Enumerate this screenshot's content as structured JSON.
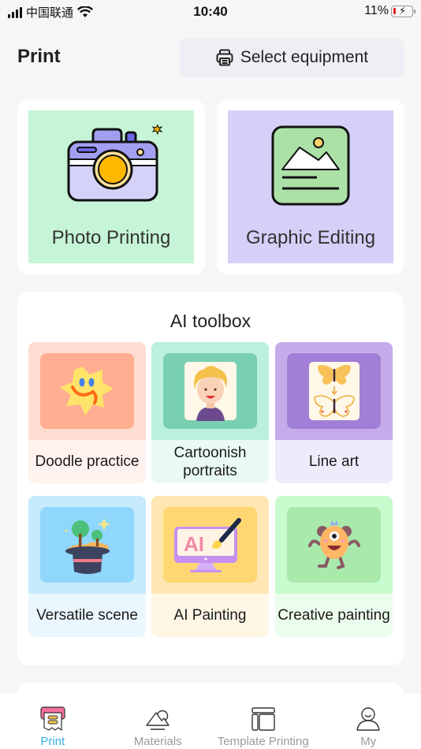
{
  "status_bar": {
    "carrier": "中国联通",
    "time": "10:40",
    "battery_percent": "11%",
    "battery_level": 0.11,
    "charging": true
  },
  "header": {
    "title": "Print",
    "select_equipment_label": "Select equipment",
    "select_equipment_icon": "printer-icon"
  },
  "main_cards": [
    {
      "label": "Photo Printing",
      "icon": "camera-icon",
      "bg": "#c6f4d6"
    },
    {
      "label": "Graphic Editing",
      "icon": "image-document-icon",
      "bg": "#d4d0f8"
    }
  ],
  "ai_toolbox": {
    "title": "AI toolbox",
    "tools": [
      {
        "label": "Doodle practice",
        "icon": "star-doodle-icon",
        "top_bg": "#ffdcd2",
        "img_bg": "#ffae92",
        "bottom_bg": "#fff2ef"
      },
      {
        "label": "Cartoonish portraits",
        "icon": "portrait-icon",
        "top_bg": "#bbf0e1",
        "img_bg": "#79cfb2",
        "bottom_bg": "#e9faf5"
      },
      {
        "label": "Line art",
        "icon": "butterfly-icon",
        "top_bg": "#c4acea",
        "img_bg": "#a17fd6",
        "bottom_bg": "#f0ebfa"
      },
      {
        "label": "Versatile scene",
        "icon": "magic-hat-icon",
        "top_bg": "#c7eafd",
        "img_bg": "#8fd7fd",
        "bottom_bg": "#ebf7fe"
      },
      {
        "label": "AI Painting",
        "icon": "ai-monitor-icon",
        "top_bg": "#ffe6b3",
        "img_bg": "#ffd772",
        "bottom_bg": "#fff6e6"
      },
      {
        "label": "Creative painting",
        "icon": "monster-icon",
        "top_bg": "#c8fbce",
        "img_bg": "#a9e9ac",
        "bottom_bg": "#ebfdec"
      }
    ]
  },
  "tabbar": {
    "active_color": "#33aee8",
    "tabs": [
      {
        "label": "Print",
        "icon": "print-tab-icon",
        "active": true
      },
      {
        "label": "Materials",
        "icon": "mountain-icon",
        "active": false
      },
      {
        "label": "Template Printing",
        "icon": "template-icon",
        "active": false
      },
      {
        "label": "My",
        "icon": "user-icon",
        "active": false
      }
    ]
  }
}
